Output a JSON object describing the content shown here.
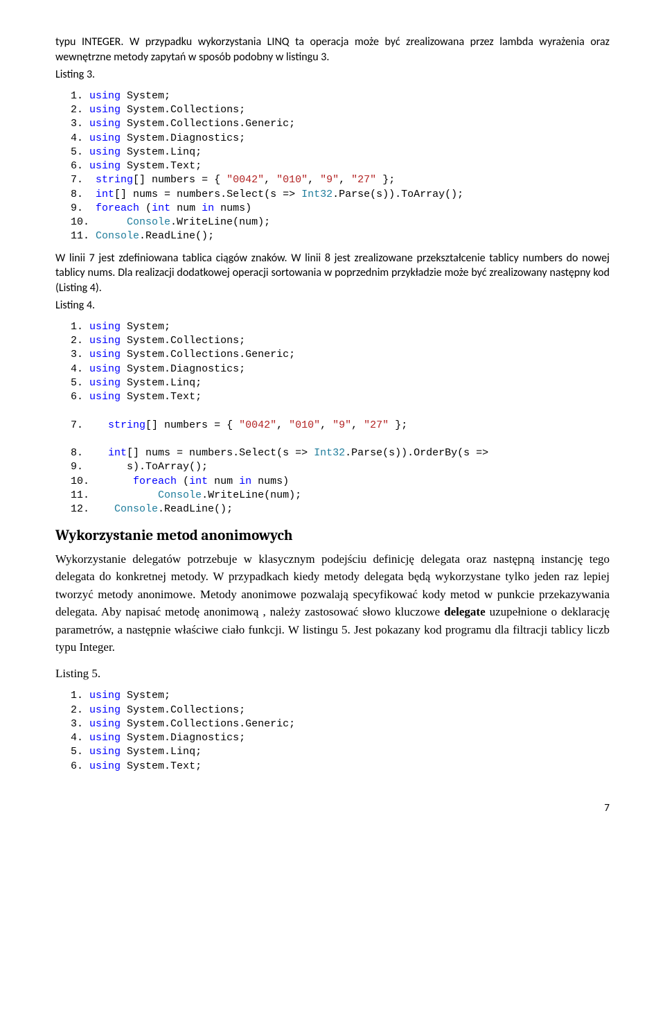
{
  "para1": "typu INTEGER.  W przypadku wykorzystania LINQ ta operacja może być zrealizowana przez  lambda wyrażenia oraz wewnętrzne metody zapytań w sposób podobny w listingu 3.",
  "listing3_label": "Listing 3.",
  "listing3": {
    "l1_num": "1.",
    "l1_kw": "using",
    "l1_rest": " System;",
    "l2_num": "2.",
    "l2_kw": "using",
    "l2_rest": " System.Collections;",
    "l3_num": "3.",
    "l3_kw": "using",
    "l3_rest": " System.Collections.Generic;",
    "l4_num": "4.",
    "l4_kw": "using",
    "l4_rest": " System.Diagnostics;",
    "l5_num": "5.",
    "l5_kw": "using",
    "l5_rest": " System.Linq;",
    "l6_num": "6.",
    "l6_kw": "using",
    "l6_rest": " System.Text;",
    "l7_num": "7.",
    "l7_a": "  ",
    "l7_kw": "string",
    "l7_b": "[] numbers = { ",
    "l7_s1": "\"0042\"",
    "l7_c": ", ",
    "l7_s2": "\"010\"",
    "l7_d": ", ",
    "l7_s3": "\"9\"",
    "l7_e": ", ",
    "l7_s4": "\"27\"",
    "l7_f": " };",
    "l8_num": "8.",
    "l8_a": "  ",
    "l8_kw": "int",
    "l8_b": "[] nums = numbers.Select(s => ",
    "l8_typ": "Int32",
    "l8_c": ".Parse(s)).ToArray();",
    "l9_num": "9.",
    "l9_a": "  ",
    "l9_kw1": "foreach",
    "l9_b": " (",
    "l9_kw2": "int",
    "l9_c": " num ",
    "l9_kw3": "in",
    "l9_d": " nums)",
    "l10_num": "10.",
    "l10_a": "      ",
    "l10_typ": "Console",
    "l10_b": ".WriteLine(num);",
    "l11_num": "11.",
    "l11_a": " ",
    "l11_typ": "Console",
    "l11_b": ".ReadLine();"
  },
  "para2": "W linii 7 jest zdefiniowana tablica ciągów znaków. W linii 8 jest zrealizowane przekształcenie tablicy numbers do nowej tablicy nums. Dla realizacji dodatkowej operacji sortowania w poprzednim przykładzie  może być zrealizowany następny  kod (Listing 4).",
  "listing4_label": "Listing 4.",
  "listing4": {
    "l1_num": "1.",
    "l1_kw": "using",
    "l1_rest": " System;",
    "l2_num": "2.",
    "l2_kw": "using",
    "l2_rest": " System.Collections;",
    "l3_num": "3.",
    "l3_kw": "using",
    "l3_rest": " System.Collections.Generic;",
    "l4_num": "4.",
    "l4_kw": "using",
    "l4_rest": " System.Diagnostics;",
    "l5_num": "5.",
    "l5_kw": "using",
    "l5_rest": " System.Linq;",
    "l6_num": "6.",
    "l6_kw": "using",
    "l6_rest": " System.Text;",
    "l7_num": "7.",
    "l7_a": "    ",
    "l7_kw": "string",
    "l7_b": "[] numbers = { ",
    "l7_s1": "\"0042\"",
    "l7_c": ", ",
    "l7_s2": "\"010\"",
    "l7_d": ", ",
    "l7_s3": "\"9\"",
    "l7_e": ", ",
    "l7_s4": "\"27\"",
    "l7_f": " };",
    "l8_num": "8.",
    "l8_a": "    ",
    "l8_kw": "int",
    "l8_b": "[] nums = numbers.Select(s => ",
    "l8_typ": "Int32",
    "l8_c": ".Parse(s)).OrderBy(s =>",
    "l9_num": "9.",
    "l9_a": "       s).ToArray();",
    "l10_num": "10.",
    "l10_a": "       ",
    "l10_kw1": "foreach",
    "l10_b": " (",
    "l10_kw2": "int",
    "l10_c": " num ",
    "l10_kw3": "in",
    "l10_d": " nums)",
    "l11_num": "11.",
    "l11_a": "           ",
    "l11_typ": "Console",
    "l11_b": ".WriteLine(num);",
    "l12_num": "12.",
    "l12_a": "    ",
    "l12_typ": "Console",
    "l12_b": ".ReadLine();"
  },
  "heading_anon": "Wykorzystanie metod anonimowych",
  "para3_a": "Wykorzystanie  delegatów potrzebuje w klasycznym podejściu  definicję delegata oraz następną instancję tego delegata do konkretnej metody. W przypadkach kiedy metody delegata będą wykorzystane tylko jeden raz lepiej tworzyć metody anonimowe. Metody anonimowe pozwalają specyfikować kody metod w punkcie przekazywania delegata. Aby napisać metodę anonimową , należy zastosować słowo kluczowe ",
  "para3_bold": "delegate",
  "para3_b": " uzupełnione o deklarację parametrów, a następnie właściwe ciało funkcji.  W listingu 5. Jest pokazany kod programu dla filtracji tablicy liczb typu Integer.",
  "listing5_label": "Listing 5.",
  "listing5": {
    "l1_num": "1.",
    "l1_kw": "using",
    "l1_rest": " System;",
    "l2_num": "2.",
    "l2_kw": "using",
    "l2_rest": " System.Collections;",
    "l3_num": "3.",
    "l3_kw": "using",
    "l3_rest": " System.Collections.Generic;",
    "l4_num": "4.",
    "l4_kw": "using",
    "l4_rest": " System.Diagnostics;",
    "l5_num": "5.",
    "l5_kw": "using",
    "l5_rest": " System.Linq;",
    "l6_num": "6.",
    "l6_kw": "using",
    "l6_rest": " System.Text;"
  },
  "page_number": "7"
}
